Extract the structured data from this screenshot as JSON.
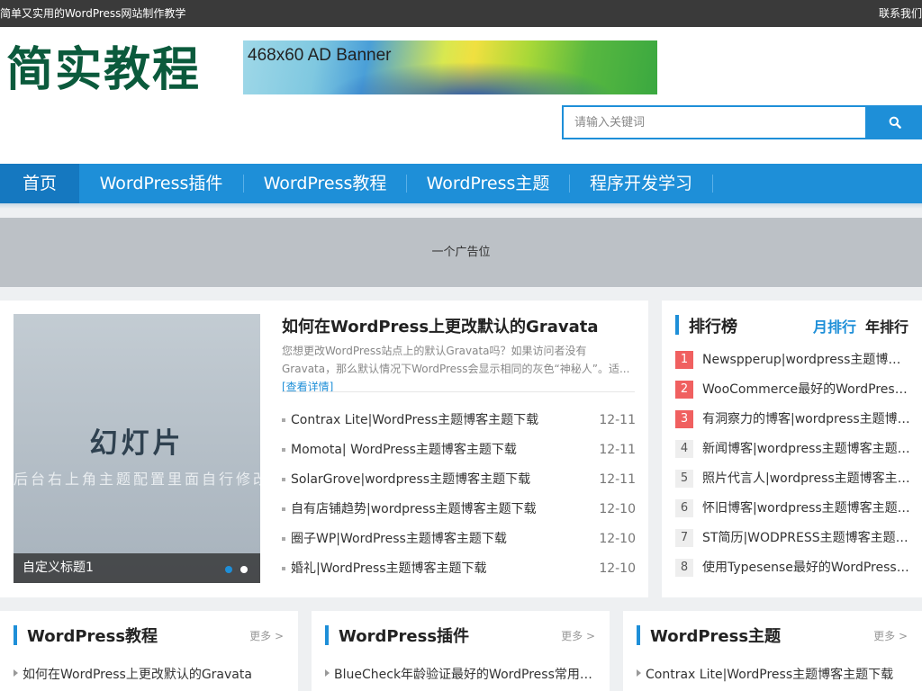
{
  "topbar": {
    "tagline": "简单又实用的WordPress网站制作教学",
    "contact": "联系我们"
  },
  "header": {
    "logo": "简实教程",
    "ad_banner": "468x60 AD Banner"
  },
  "search": {
    "placeholder": "请输入关键词",
    "icon": "search-icon"
  },
  "nav": {
    "items": [
      {
        "label": "首页",
        "active": true
      },
      {
        "label": "WordPress插件"
      },
      {
        "label": "WordPress教程"
      },
      {
        "label": "WordPress主题"
      },
      {
        "label": "程序开发学习"
      }
    ]
  },
  "ad_strip": {
    "text": "一个广告位"
  },
  "slider": {
    "title": "幻灯片",
    "subtitle": "后台右上角主题配置里面自行修改",
    "caption": "自定义标题1",
    "dot_count": 2,
    "active_dot": 1
  },
  "featured": {
    "title": "如何在WordPress上更改默认的Gravata",
    "excerpt": "您想更改WordPress站点上的默认Gravata吗？如果访问者没有Gravata，那么默认情况下WordPress会显示相同的灰色“神秘人”。适...",
    "more": "[查看详情]"
  },
  "posts": [
    {
      "title": "Contrax Lite|WordPress主题博客主题下载",
      "date": "12-11"
    },
    {
      "title": "Momota| WordPress主题博客主题下载",
      "date": "12-11"
    },
    {
      "title": "SolarGrove|wordpress主题博客主题下载",
      "date": "12-11"
    },
    {
      "title": "自有店铺趋势|wordpress主题博客主题下载",
      "date": "12-10"
    },
    {
      "title": "圈子WP|WordPress主题博客主题下载",
      "date": "12-10"
    },
    {
      "title": "婚礼|WordPress主题博客主题下载",
      "date": "12-10"
    }
  ],
  "ranking": {
    "title": "排行榜",
    "tab_month": "月排行",
    "tab_year": "年排行",
    "items": [
      {
        "rank": "1",
        "text": "Newspperup|wordpress主题博客主题下载"
      },
      {
        "rank": "2",
        "text": "WooCommerce最好的WordPress插件"
      },
      {
        "rank": "3",
        "text": "有洞察力的博客|wordpress主题博客主题下载"
      },
      {
        "rank": "4",
        "text": "新闻博客|wordpress主题博客主题下载"
      },
      {
        "rank": "5",
        "text": "照片代言人|wordpress主题博客主题下载"
      },
      {
        "rank": "6",
        "text": "怀旧博客|wordpress主题博客主题下载"
      },
      {
        "rank": "7",
        "text": "ST简历|WODPRESS主题博客主题下载"
      },
      {
        "rank": "8",
        "text": "使用Typesense最好的WordPress搜索插件"
      }
    ]
  },
  "sections": [
    {
      "title": "WordPress教程",
      "more": "更多 >",
      "first_item": "如何在WordPress上更改默认的Gravata"
    },
    {
      "title": "WordPress插件",
      "more": "更多 >",
      "first_item": "BlueCheck年龄验证最好的WordPress常用插件"
    },
    {
      "title": "WordPress主题",
      "more": "更多 >",
      "first_item": "Contrax Lite|WordPress主题博客主题下载"
    }
  ],
  "colors": {
    "brand_blue": "#1e8fd8",
    "logo_green": "#0b5a3c",
    "hot_rank": "#f06060",
    "topbar": "#3a3a3a"
  }
}
